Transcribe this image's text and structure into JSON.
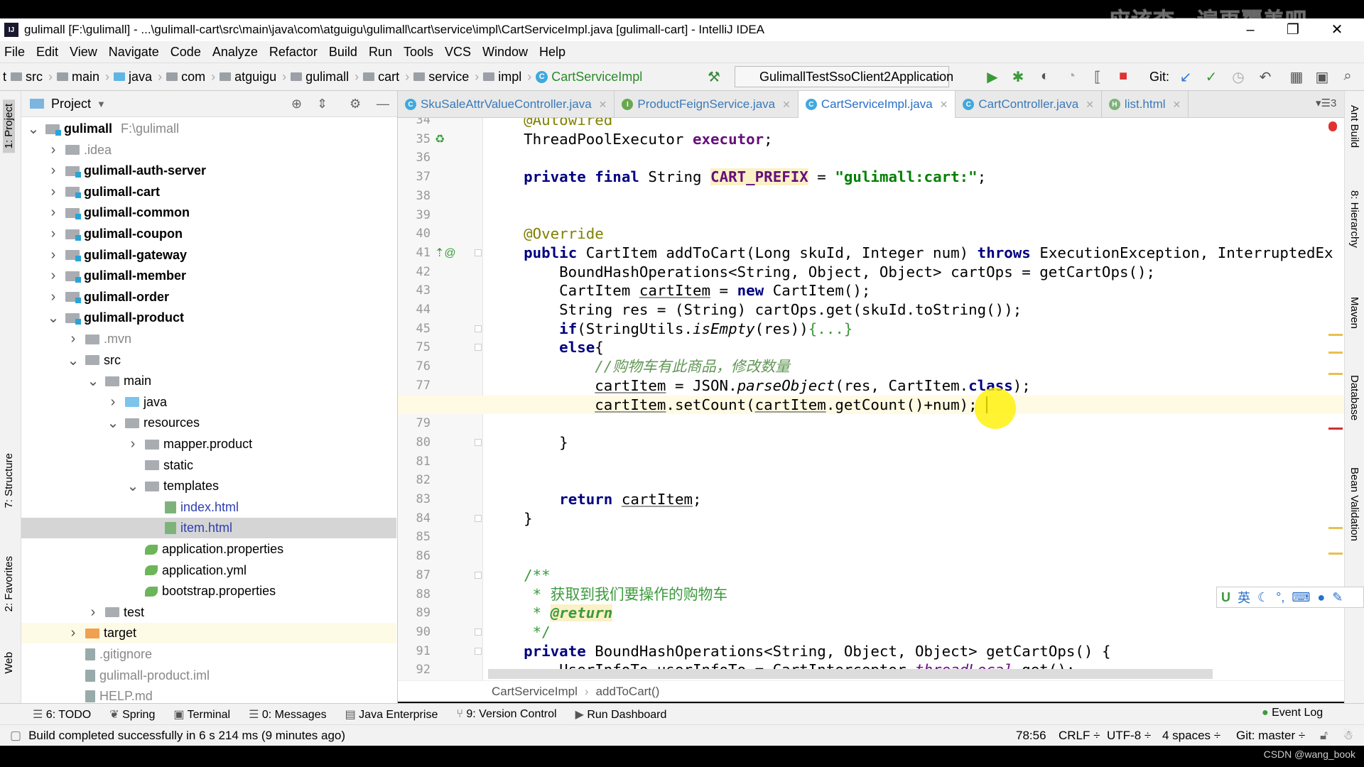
{
  "window": {
    "title": "gulimall [F:\\gulimall] - ...\\gulimall-cart\\src\\main\\java\\com\\atguigu\\gulimall\\cart\\service\\impl\\CartServiceImpl.java [gulimall-cart] - IntelliJ IDEA",
    "logo": "IJ",
    "overlay_text": "应该查一遍再覆盖吧"
  },
  "menu": [
    "File",
    "Edit",
    "View",
    "Navigate",
    "Code",
    "Analyze",
    "Refactor",
    "Build",
    "Run",
    "Tools",
    "VCS",
    "Window",
    "Help"
  ],
  "nav": {
    "lead": "t",
    "crumbs": [
      "src",
      "main",
      "java",
      "com",
      "atguigu",
      "gulimall",
      "cart",
      "service",
      "impl"
    ],
    "file": "CartServiceImpl",
    "run_config": "GulimallTestSsoClient2Application",
    "git_label": "Git:"
  },
  "project": {
    "title": "Project",
    "tree": [
      {
        "label": "gulimall",
        "extra": "F:\\gulimall",
        "depth": 0,
        "arrow": "v",
        "icon": "mod",
        "style": "bold"
      },
      {
        "label": ".idea",
        "depth": 1,
        "arrow": ">",
        "icon": "folder",
        "style": "dim"
      },
      {
        "label": "gulimall-auth-server",
        "depth": 1,
        "arrow": ">",
        "icon": "mod",
        "style": "bold"
      },
      {
        "label": "gulimall-cart",
        "depth": 1,
        "arrow": ">",
        "icon": "mod",
        "style": "bold"
      },
      {
        "label": "gulimall-common",
        "depth": 1,
        "arrow": ">",
        "icon": "mod",
        "style": "bold"
      },
      {
        "label": "gulimall-coupon",
        "depth": 1,
        "arrow": ">",
        "icon": "mod",
        "style": "bold"
      },
      {
        "label": "gulimall-gateway",
        "depth": 1,
        "arrow": ">",
        "icon": "mod",
        "style": "bold"
      },
      {
        "label": "gulimall-member",
        "depth": 1,
        "arrow": ">",
        "icon": "mod",
        "style": "bold"
      },
      {
        "label": "gulimall-order",
        "depth": 1,
        "arrow": ">",
        "icon": "mod",
        "style": "bold"
      },
      {
        "label": "gulimall-product",
        "depth": 1,
        "arrow": "v",
        "icon": "mod",
        "style": "bold"
      },
      {
        "label": ".mvn",
        "depth": 2,
        "arrow": ">",
        "icon": "folder",
        "style": "dim"
      },
      {
        "label": "src",
        "depth": 2,
        "arrow": "v",
        "icon": "folder",
        "style": ""
      },
      {
        "label": "main",
        "depth": 3,
        "arrow": "v",
        "icon": "folder",
        "style": ""
      },
      {
        "label": "java",
        "depth": 4,
        "arrow": ">",
        "icon": "src",
        "style": ""
      },
      {
        "label": "resources",
        "depth": 4,
        "arrow": "v",
        "icon": "folder",
        "style": ""
      },
      {
        "label": "mapper.product",
        "depth": 5,
        "arrow": ">",
        "icon": "folder",
        "style": ""
      },
      {
        "label": "static",
        "depth": 5,
        "arrow": "",
        "icon": "folder",
        "style": ""
      },
      {
        "label": "templates",
        "depth": 5,
        "arrow": "v",
        "icon": "folder",
        "style": ""
      },
      {
        "label": "index.html",
        "depth": 6,
        "arrow": "",
        "icon": "html",
        "style": "blue"
      },
      {
        "label": "item.html",
        "depth": 6,
        "arrow": "",
        "icon": "html",
        "style": "blue",
        "selected": true
      },
      {
        "label": "application.properties",
        "depth": 5,
        "arrow": "",
        "icon": "leaf",
        "style": ""
      },
      {
        "label": "application.yml",
        "depth": 5,
        "arrow": "",
        "icon": "leaf",
        "style": ""
      },
      {
        "label": "bootstrap.properties",
        "depth": 5,
        "arrow": "",
        "icon": "leaf",
        "style": ""
      },
      {
        "label": "test",
        "depth": 3,
        "arrow": ">",
        "icon": "folder",
        "style": ""
      },
      {
        "label": "target",
        "depth": 2,
        "arrow": ">",
        "icon": "tgt",
        "style": "",
        "highlight": true
      },
      {
        "label": ".gitignore",
        "depth": 2,
        "arrow": "",
        "icon": "file",
        "style": "dim"
      },
      {
        "label": "gulimall-product.iml",
        "depth": 2,
        "arrow": "",
        "icon": "file",
        "style": "dim"
      },
      {
        "label": "HELP.md",
        "depth": 2,
        "arrow": "",
        "icon": "file",
        "style": "dim"
      }
    ]
  },
  "left_tabs": [
    "1: Project",
    "7: Structure",
    "2: Favorites",
    "Web"
  ],
  "right_tabs": [
    "Ant Build",
    "8: Hierarchy",
    "Maven",
    "Database",
    "Bean Validation"
  ],
  "tabs": [
    {
      "label": "SkuSaleAttrValueController.java",
      "icon": "C",
      "color": "#3fa9dd"
    },
    {
      "label": "ProductFeignService.java",
      "icon": "I",
      "color": "#6aa84f"
    },
    {
      "label": "CartServiceImpl.java",
      "icon": "C",
      "color": "#3fa9dd",
      "active": true
    },
    {
      "label": "CartController.java",
      "icon": "C",
      "color": "#3fa9dd"
    },
    {
      "label": "list.html",
      "icon": "H",
      "color": "#7db37b"
    }
  ],
  "tabs_overflow": "3",
  "code": [
    {
      "n": "34",
      "t": [
        [
          "    ",
          ""
        ],
        [
          "@Autowired",
          "ann"
        ]
      ]
    },
    {
      "n": "35",
      "t": [
        [
          "    ThreadPoolExecutor ",
          ""
        ],
        [
          "executor",
          "fld"
        ],
        [
          ";",
          ""
        ]
      ]
    },
    {
      "n": "36",
      "t": []
    },
    {
      "n": "37",
      "t": [
        [
          "    ",
          ""
        ],
        [
          "private final ",
          "kw"
        ],
        [
          "String ",
          ""
        ],
        [
          "CART_PREFIX",
          "fld hlc"
        ],
        [
          " = ",
          ""
        ],
        [
          "\"gulimall:cart:\"",
          "str"
        ],
        [
          ";",
          ""
        ]
      ]
    },
    {
      "n": "38",
      "t": []
    },
    {
      "n": "39",
      "t": []
    },
    {
      "n": "40",
      "t": [
        [
          "    ",
          ""
        ],
        [
          "@Override",
          "ann"
        ]
      ]
    },
    {
      "n": "41",
      "t": [
        [
          "    ",
          ""
        ],
        [
          "public ",
          "kw"
        ],
        [
          "CartItem addToCart(Long skuId, Integer num) ",
          ""
        ],
        [
          "throws ",
          "kw"
        ],
        [
          "ExecutionException, InterruptedEx",
          ""
        ]
      ]
    },
    {
      "n": "42",
      "t": [
        [
          "        BoundHashOperations<String, Object, Object> cartOps = getCartOps();",
          ""
        ]
      ]
    },
    {
      "n": "43",
      "t": [
        [
          "        CartItem ",
          ""
        ],
        [
          "cartItem",
          "ul"
        ],
        [
          " = ",
          ""
        ],
        [
          "new ",
          "kw"
        ],
        [
          "CartItem();",
          ""
        ]
      ]
    },
    {
      "n": "44",
      "t": [
        [
          "        String res = (String) cartOps.get(skuId.toString());",
          ""
        ]
      ]
    },
    {
      "n": "45",
      "t": [
        [
          "        ",
          ""
        ],
        [
          "if",
          "kw"
        ],
        [
          "(StringUtils.",
          ""
        ],
        [
          "isEmpty",
          "it"
        ],
        [
          "(res))",
          ""
        ],
        [
          "{...}",
          "cmt"
        ]
      ]
    },
    {
      "n": "75",
      "t": [
        [
          "        ",
          ""
        ],
        [
          "else",
          "kw"
        ],
        [
          "{",
          ""
        ]
      ]
    },
    {
      "n": "76",
      "t": [
        [
          "            ",
          ""
        ],
        [
          "//购物车有此商品，修改数量",
          "cm"
        ]
      ]
    },
    {
      "n": "77",
      "t": [
        [
          "            ",
          ""
        ],
        [
          "cartItem",
          "ul"
        ],
        [
          " = JSON.",
          ""
        ],
        [
          "parseObject",
          "it"
        ],
        [
          "(res, CartItem.",
          ""
        ],
        [
          "class",
          "kw"
        ],
        [
          ");",
          ""
        ]
      ]
    },
    {
      "n": "78",
      "t": [
        [
          "            ",
          ""
        ],
        [
          "cartItem",
          "ul"
        ],
        [
          ".setCount(",
          ""
        ],
        [
          "cartItem",
          "ul"
        ],
        [
          ".getCount()+num);",
          ""
        ]
      ],
      "current": true
    },
    {
      "n": "79",
      "t": []
    },
    {
      "n": "80",
      "t": [
        [
          "        }",
          ""
        ]
      ]
    },
    {
      "n": "81",
      "t": []
    },
    {
      "n": "82",
      "t": []
    },
    {
      "n": "83",
      "t": [
        [
          "        ",
          ""
        ],
        [
          "return ",
          "kw"
        ],
        [
          "cartItem",
          "ul"
        ],
        [
          ";",
          ""
        ]
      ]
    },
    {
      "n": "84",
      "t": [
        [
          "    }",
          ""
        ]
      ]
    },
    {
      "n": "85",
      "t": []
    },
    {
      "n": "86",
      "t": []
    },
    {
      "n": "87",
      "t": [
        [
          "    ",
          ""
        ],
        [
          "/**",
          "doc"
        ]
      ]
    },
    {
      "n": "88",
      "t": [
        [
          "     ",
          ""
        ],
        [
          "* 获取到我们要操作的购物车",
          "doc"
        ]
      ]
    },
    {
      "n": "89",
      "t": [
        [
          "     ",
          ""
        ],
        [
          "* ",
          "doc"
        ],
        [
          "@return",
          "doctag"
        ]
      ]
    },
    {
      "n": "90",
      "t": [
        [
          "     ",
          ""
        ],
        [
          "*/",
          "doc"
        ]
      ]
    },
    {
      "n": "91",
      "t": [
        [
          "    ",
          ""
        ],
        [
          "private ",
          "kw"
        ],
        [
          "BoundHashOperations<String, Object, Object> getCartOps() {",
          ""
        ]
      ]
    },
    {
      "n": "92",
      "t": [
        [
          "        UserInfoTo userInfoTo = CartInterceptor.",
          ""
        ],
        [
          "threadLocal",
          "sfld"
        ],
        [
          ".get();",
          ""
        ]
      ]
    }
  ],
  "editor_breadcrumb": [
    "CartServiceImpl",
    "addToCart()"
  ],
  "tool_windows": [
    "6: TODO",
    "Spring",
    "Terminal",
    "0: Messages",
    "Java Enterprise",
    "9: Version Control",
    "Run Dashboard"
  ],
  "event_log": "Event Log",
  "status": {
    "message": "Build completed successfully in 6 s 214 ms (9 minutes ago)",
    "position": "78:56",
    "line_sep": "CRLF ÷",
    "encoding": "UTF-8 ÷",
    "indent": "4 spaces ÷",
    "git": "Git: master ÷"
  },
  "ime": "英",
  "credit": "CSDN @wang_book"
}
